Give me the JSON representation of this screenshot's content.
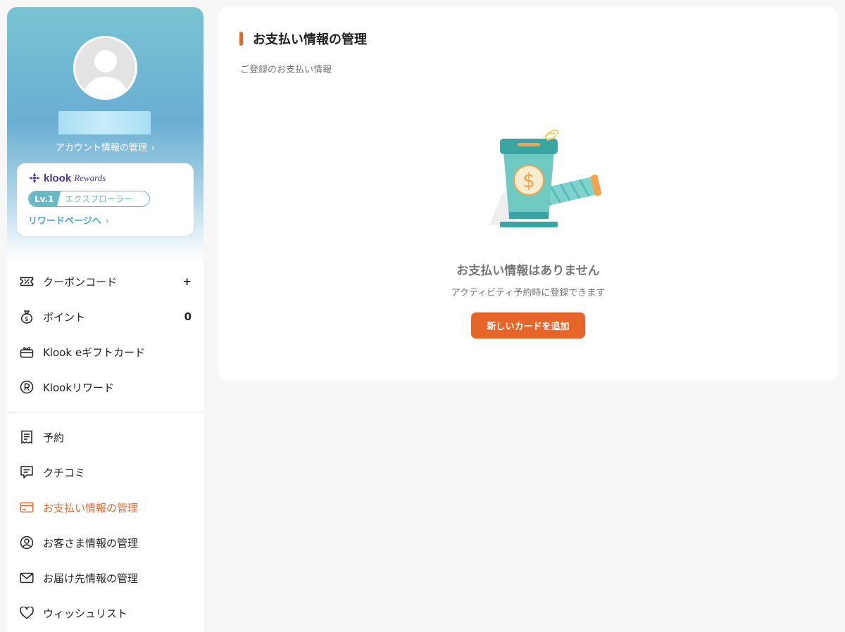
{
  "sidebar": {
    "account_link": "アカウント情報の管理",
    "rewards": {
      "brand": "klook",
      "script": "Rewards",
      "level": "Lv.1",
      "level_name": "エクスプローラー",
      "link": "リワードページへ"
    },
    "menu_group_1": [
      {
        "label": "クーポンコード",
        "icon": "ticket-icon",
        "right": "+"
      },
      {
        "label": "ポイント",
        "icon": "money-bag-icon",
        "right": "0"
      },
      {
        "label": "Klook eギフトカード",
        "icon": "gift-card-icon",
        "right": ""
      },
      {
        "label": "Klookリワード",
        "icon": "rewards-icon",
        "right": ""
      }
    ],
    "menu_group_2": [
      {
        "label": "予約",
        "icon": "receipt-icon"
      },
      {
        "label": "クチコミ",
        "icon": "review-icon"
      },
      {
        "label": "お支払い情報の管理",
        "icon": "credit-card-icon",
        "active": true
      },
      {
        "label": "お客さま情報の管理",
        "icon": "user-circle-icon"
      },
      {
        "label": "お届け先情報の管理",
        "icon": "mail-icon"
      },
      {
        "label": "ウィッシュリスト",
        "icon": "heart-icon"
      }
    ]
  },
  "main": {
    "title": "お支払い情報の管理",
    "subtitle": "ご登録のお支払い情報",
    "empty_title": "お支払い情報はありません",
    "empty_desc": "アクティビティ予約時に登録できます",
    "add_button": "新しいカードを追加"
  },
  "colors": {
    "accent": "#e8652a",
    "teal": "#6ab8c5",
    "brand_purple": "#4c3a93"
  }
}
